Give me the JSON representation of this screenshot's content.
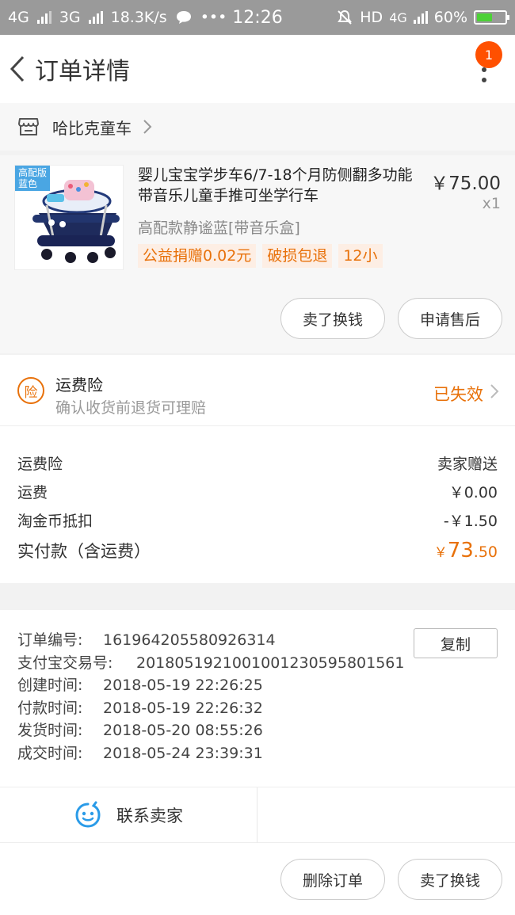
{
  "status_bar": {
    "net1": "4G",
    "net2": "3G",
    "speed": "18.3K/s",
    "dots": "•••",
    "time": "12:26",
    "hd": "HD",
    "net3": "4G",
    "battery": "60%",
    "battery_level": 0.6,
    "battery_color": "#4cd137"
  },
  "header": {
    "title": "订单详情",
    "badge": "1"
  },
  "shop": {
    "name": "哈比克童车"
  },
  "item": {
    "thumb_badge_line1": "高配版",
    "thumb_badge_line2": "蓝色",
    "title": "婴儿宝宝学步车6/7-18个月防侧翻多功能带音乐儿童手推可坐学行车",
    "price": "￥75.00",
    "qty": "x1",
    "spec": "高配款静谧蓝[带音乐盒]",
    "tags": [
      "公益捐赠0.02元",
      "破损包退",
      "12小"
    ],
    "buttons": {
      "sell": "卖了换钱",
      "after_sale": "申请售后"
    }
  },
  "insurance": {
    "icon_char": "险",
    "title": "运费险",
    "subtitle": "确认收货前退货可理赔",
    "status": "已失效"
  },
  "fees": {
    "rows": [
      {
        "label": "运费险",
        "value": "卖家赠送"
      },
      {
        "label": "运费",
        "value": "￥0.00"
      },
      {
        "label": "淘金币抵扣",
        "value": "-￥1.50"
      }
    ],
    "total_label": "实付款（含运费）",
    "total_symbol": "￥",
    "total_int": "73",
    "total_dec": ".50"
  },
  "order_info": {
    "copy_label": "复制",
    "rows": [
      {
        "label": "订单编号:",
        "value": "161964205580926314"
      },
      {
        "label": "支付宝交易号:",
        "value": "2018051921001001230595801561"
      },
      {
        "label": "创建时间:",
        "value": "2018-05-19 22:26:25"
      },
      {
        "label": "付款时间:",
        "value": "2018-05-19 22:26:32"
      },
      {
        "label": "发货时间:",
        "value": "2018-05-20 08:55:26"
      },
      {
        "label": "成交时间:",
        "value": "2018-05-24 23:39:31"
      }
    ]
  },
  "contact": {
    "label": "联系卖家"
  },
  "bottom": {
    "delete": "删除订单",
    "sell": "卖了换钱"
  },
  "colors": {
    "accent": "#e8710a",
    "badge": "#ff5000"
  }
}
